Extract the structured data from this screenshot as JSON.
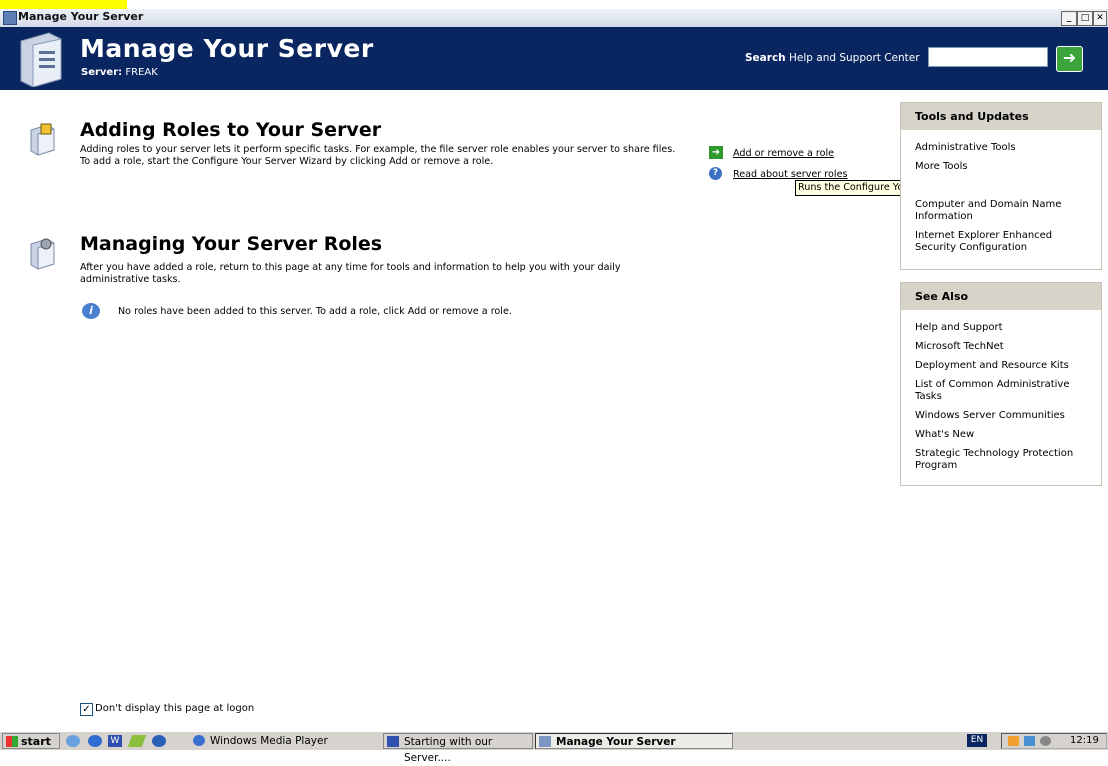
{
  "window": {
    "title": "Manage Your Server",
    "buttons": [
      "_",
      "̄",
      "X"
    ]
  },
  "header": {
    "title": "Manage Your Server",
    "server_label": "Server:",
    "server_name": "FREAK",
    "search_label": "Search",
    "search_suffix": "Help and Support Center",
    "search_value": "",
    "go_icon": "green-arrow-icon"
  },
  "sections": [
    {
      "title": "Adding Roles to Your Server",
      "description": "Adding roles to your server lets it perform specific tasks. For example, the file server role enables your server to share files. To add a role, start the Configure Your Server Wizard by clicking Add or remove a role.",
      "actions": [
        {
          "label": "Add or remove a role",
          "icon": "green-arrow-icon"
        },
        {
          "label": "Read about server roles",
          "icon": "help-icon"
        }
      ]
    },
    {
      "title": "Managing Your Server Roles",
      "description": "After you have added a role, return to this page at any time for tools and information to help you with your daily administrative tasks.",
      "info": "No roles have been added to this server. To add a role, click Add or remove a role."
    }
  ],
  "tooltip": "Runs the Configure Your Server Wizard.",
  "tools_panel": {
    "title": "Tools and Updates",
    "items": [
      "Administrative Tools",
      "More Tools",
      "",
      "Computer and Domain Name Information",
      "Internet Explorer Enhanced Security Configuration"
    ]
  },
  "see_also_panel": {
    "title": "See Also",
    "items": [
      "Help and Support",
      "Microsoft TechNet",
      "Deployment and Resource Kits",
      "List of Common Administrative Tasks",
      "Windows Server Communities",
      "What's New",
      "Strategic Technology Protection Program"
    ]
  },
  "logon_checkbox": {
    "label": "Don't display this page at logon",
    "checked": true
  },
  "taskbar": {
    "start": "start",
    "tasks": [
      "Windows Media Player",
      "Starting with our Server....",
      "Manage Your Server"
    ],
    "language": "EN",
    "clock": "12:19"
  },
  "colors": {
    "header_bg": "#0a2661",
    "panel_header": "#d6d3c8",
    "tooltip_bg": "#ffffe1"
  }
}
